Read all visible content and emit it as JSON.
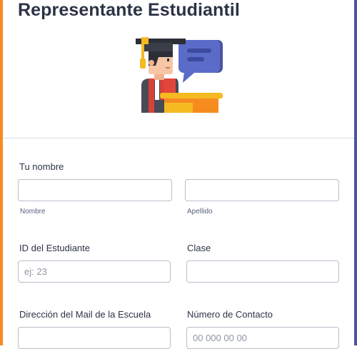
{
  "colors": {
    "left_edge": "#f68b1f",
    "right_edge": "#4a55a2"
  },
  "form": {
    "title": "Representante Estudiantil",
    "illustration_icon": "graduate-student-speech-bubble-icon",
    "name": {
      "label": "Tu nombre",
      "first": {
        "value": "",
        "placeholder": "",
        "sublabel": "Nombre"
      },
      "last": {
        "value": "",
        "placeholder": "",
        "sublabel": "Apellido"
      }
    },
    "student_id": {
      "label": "ID del Estudiante",
      "value": "",
      "placeholder": "ej: 23"
    },
    "class": {
      "label": "Clase",
      "value": "",
      "placeholder": ""
    },
    "school_email": {
      "label": "Dirección del Mail de la Escuela",
      "value": "",
      "placeholder": ""
    },
    "contact_number": {
      "label": "Número de Contacto",
      "value": "",
      "placeholder": "00 000 00 00"
    }
  }
}
